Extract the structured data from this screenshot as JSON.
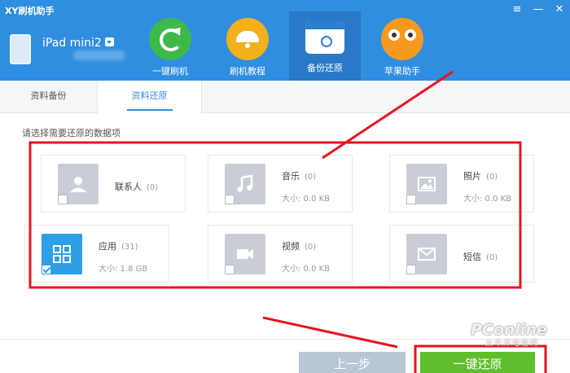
{
  "app": {
    "title": "XY刷机助手",
    "window_controls": [
      "≡",
      "—",
      "✕"
    ]
  },
  "device": {
    "name": "iPad mini2"
  },
  "nav": [
    {
      "label": "一键刷机",
      "icon": "refresh-icon",
      "color": "#3fb84a"
    },
    {
      "label": "刷机教程",
      "icon": "lamp-icon",
      "color": "#f3b01c"
    },
    {
      "label": "备份还原",
      "icon": "backup-icon",
      "color": "#2b7fd0",
      "active": true
    },
    {
      "label": "苹果助手",
      "icon": "owl-icon",
      "color": "#f59a1f"
    }
  ],
  "tabs": [
    {
      "label": "资料备份"
    },
    {
      "label": "资料还原",
      "active": true
    }
  ],
  "prompt": "请选择需要还原的数据项",
  "cards": [
    {
      "title": "联系人",
      "count": "(0)",
      "size": "",
      "icon": "contacts-icon",
      "checked": false
    },
    {
      "title": "音乐",
      "count": "(0)",
      "size": "大小: 0.0 KB",
      "icon": "music-icon",
      "checked": false
    },
    {
      "title": "照片",
      "count": "(0)",
      "size": "大小: 0.0 KB",
      "icon": "photo-icon",
      "checked": false
    },
    {
      "title": "应用",
      "count": "(31)",
      "size": "大小: 1.8 GB",
      "icon": "apps-icon",
      "checked": true
    },
    {
      "title": "视频",
      "count": "(0)",
      "size": "大小: 0.0 KB",
      "icon": "video-icon",
      "checked": false
    },
    {
      "title": "短信",
      "count": "(0)",
      "size": "",
      "icon": "message-icon",
      "checked": false
    }
  ],
  "buttons": {
    "prev": "上一步",
    "restore": "一键还原"
  },
  "watermark": {
    "brand": "PConline",
    "sub": "太平洋电脑网"
  },
  "colors": {
    "header": "#2f8ee0",
    "accent": "#2c9fe6",
    "annotation": "#e8141c",
    "restore_button": "#5fbe2b"
  }
}
